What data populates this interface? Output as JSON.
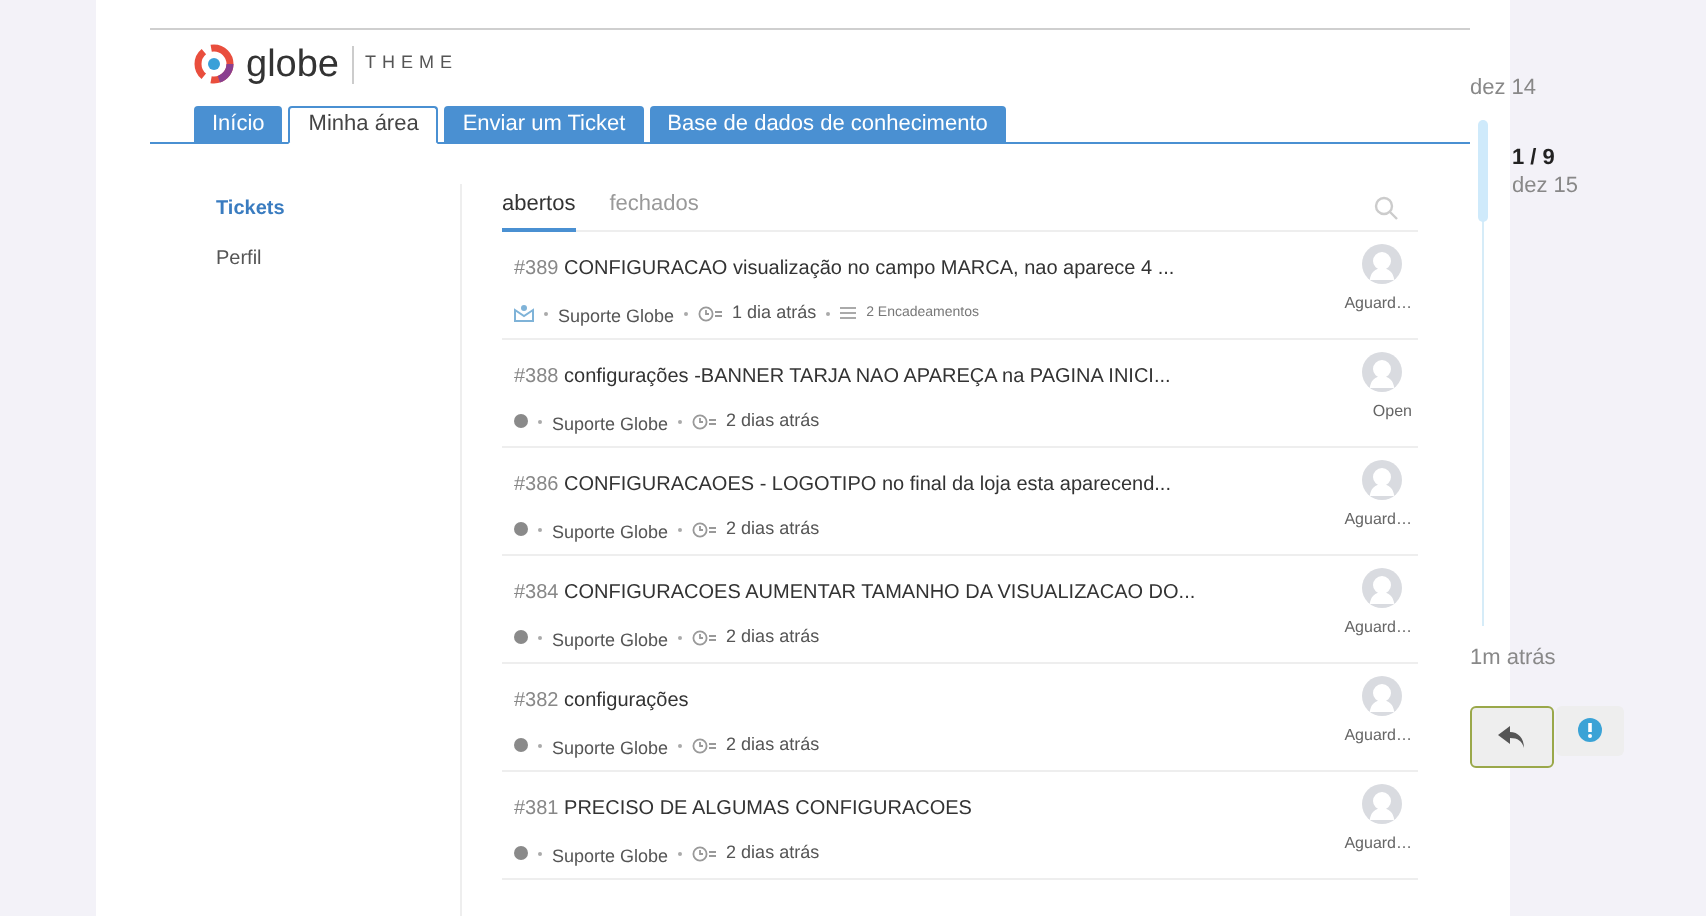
{
  "logo": {
    "name": "globe",
    "tagline": "THEME"
  },
  "nav_tabs": [
    {
      "label": "Início",
      "selected": false
    },
    {
      "label": "Minha área",
      "selected": true
    },
    {
      "label": "Enviar um Ticket",
      "selected": false
    },
    {
      "label": "Base de dados de conhecimento",
      "selected": false
    }
  ],
  "sidebar": {
    "items": [
      {
        "label": "Tickets",
        "selected": true
      },
      {
        "label": "Perfil",
        "selected": false
      }
    ]
  },
  "list_tabs": [
    {
      "label": "abertos",
      "selected": true
    },
    {
      "label": "fechados",
      "selected": false
    }
  ],
  "tickets": [
    {
      "number": "#389",
      "title": "CONFIGURACAO visualização no campo MARCA, nao aparece 4 ...",
      "kind": "email",
      "agent": "Suporte Globe",
      "time": "1 dia atrás",
      "threads": "2 Encadeamentos",
      "status": "Aguard…"
    },
    {
      "number": "#388",
      "title": "configurações -BANNER TARJA NAO APAREÇA na PAGINA INICI...",
      "kind": "web",
      "agent": "Suporte Globe",
      "time": "2 dias atrás",
      "status": "Open"
    },
    {
      "number": "#386",
      "title": "CONFIGURACAOES - LOGOTIPO no final da loja esta aparecend...",
      "kind": "web",
      "agent": "Suporte Globe",
      "time": "2 dias atrás",
      "status": "Aguard…"
    },
    {
      "number": "#384",
      "title": "CONFIGURACOES AUMENTAR TAMANHO DA VISUALIZACAO DO...",
      "kind": "web",
      "agent": "Suporte Globe",
      "time": "2 dias atrás",
      "status": "Aguard…"
    },
    {
      "number": "#382",
      "title": "configurações",
      "kind": "web",
      "agent": "Suporte Globe",
      "time": "2 dias atrás",
      "status": "Aguard…"
    },
    {
      "number": "#381",
      "title": "PRECISO DE ALGUMAS CONFIGURACOES",
      "kind": "web",
      "agent": "Suporte Globe",
      "time": "2 dias atrás",
      "status": "Aguard…"
    }
  ],
  "timeline": {
    "start": "dez 14",
    "position": "1 / 9",
    "current": "dez 15",
    "end": "1m atrás",
    "level": 0.2
  }
}
